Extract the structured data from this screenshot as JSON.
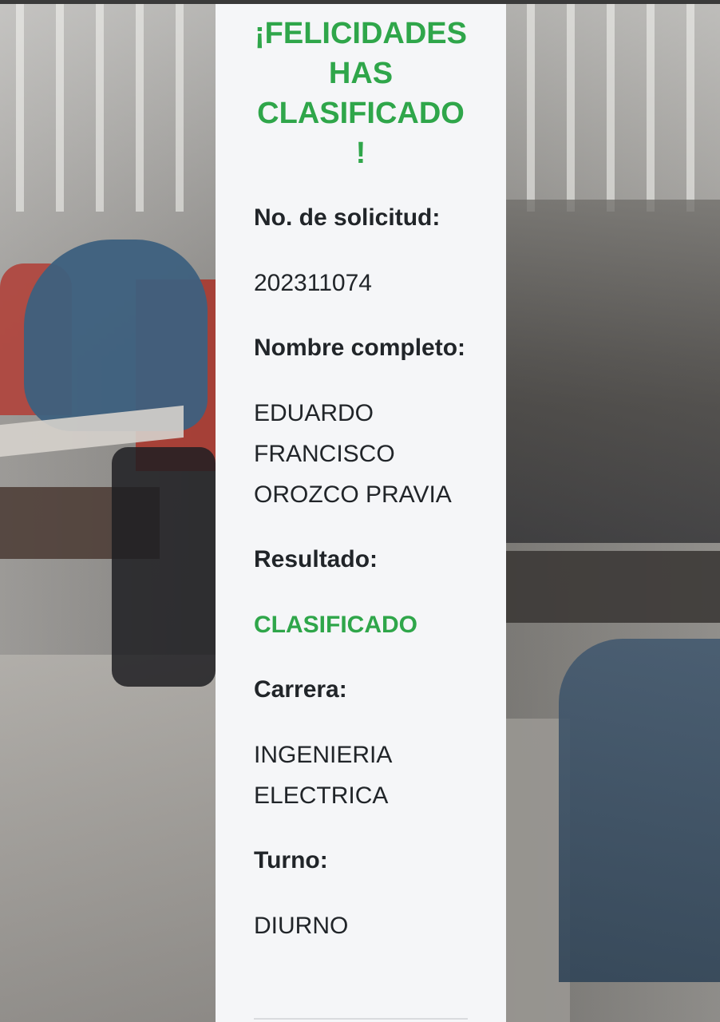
{
  "result_card": {
    "headline": "¡FELICIDADES HAS CLASIFICADO !",
    "fields": {
      "solicitud_label": "No. de solicitud:",
      "solicitud_value": "202311074",
      "nombre_label": "Nombre completo:",
      "nombre_value": "EDUARDO FRANCISCO OROZCO PRAVIA",
      "resultado_label": "Resultado:",
      "resultado_value": "CLASIFICADO",
      "carrera_label": "Carrera:",
      "carrera_value": "INGENIERIA ELECTRICA",
      "turno_label": "Turno:",
      "turno_value": "DIURNO"
    }
  },
  "colors": {
    "accent_green": "#2fa64a",
    "text_dark": "#212529",
    "card_background": "#f5f6f8"
  }
}
